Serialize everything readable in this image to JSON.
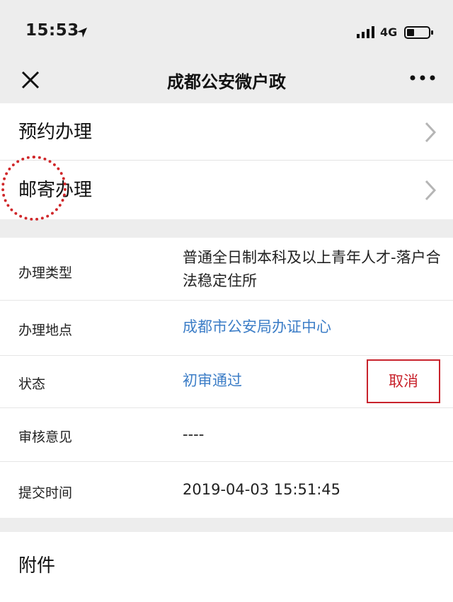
{
  "status_bar": {
    "time": "15:53",
    "network": "4G"
  },
  "nav": {
    "title": "成都公安微户政"
  },
  "menu": [
    {
      "label": "预约办理"
    },
    {
      "label": "邮寄办理"
    }
  ],
  "details": {
    "type_key": "办理类型",
    "type_value": "普通全日制本科及以上青年人才-落户合法稳定住所",
    "location_key": "办理地点",
    "location_value": "成都市公安局办证中心",
    "status_key": "状态",
    "status_value": "初审通过",
    "cancel_label": "取消",
    "review_key": "审核意见",
    "review_value": "----",
    "submit_key": "提交时间",
    "submit_value": "2019-04-03 15:51:45"
  },
  "attachment": {
    "label": "附件"
  },
  "colors": {
    "link": "#3d7ec7",
    "cancel": "#c8232c",
    "annotation": "#d0282b"
  }
}
